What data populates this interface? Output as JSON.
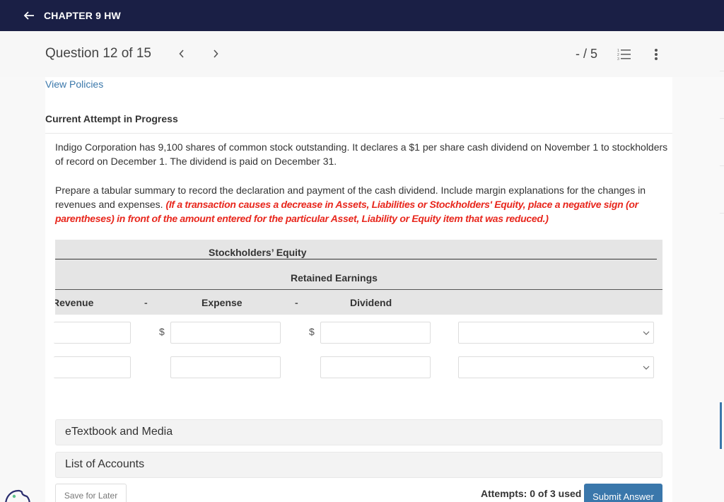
{
  "topbar": {
    "title": "CHAPTER 9 HW",
    "back_icon": "arrow-left-icon"
  },
  "question_header": {
    "title": "Question 12 of 15",
    "prev_icon": "chevron-left-icon",
    "next_icon": "chevron-right-icon",
    "score": "- / 5",
    "list_icon": "numbered-list-icon",
    "more_icon": "vertical-dots-icon"
  },
  "links": {
    "view_policies": "View Policies"
  },
  "attempt_title": "Current Attempt in Progress",
  "problem": {
    "paragraph1": "Indigo Corporation has 9,100 shares of common stock outstanding. It declares a $1 per share cash dividend on November 1 to stockholders of record on December 1. The dividend is paid on December 31.",
    "paragraph2_plain": "Prepare a tabular summary to record the declaration and payment of the cash dividend. Include margin explanations for the changes in revenues and expenses. ",
    "paragraph2_emphasis": "(If a transaction causes a decrease in Assets, Liabilities or Stockholders' Equity, place a negative sign (or parentheses) in front of the amount entered for the particular Asset, Liability or Equity item that was reduced.)"
  },
  "table": {
    "group_header": "Stockholders’ Equity",
    "sub_header": "Retained Earnings",
    "columns": [
      "Revenue",
      "-",
      "Expense",
      "-",
      "Dividend"
    ],
    "currency_symbol": "$",
    "rows": [
      {
        "revenue": "",
        "expense": "",
        "dividend": "",
        "explanation": "",
        "show_currency": true
      },
      {
        "revenue": "",
        "expense": "",
        "dividend": "",
        "explanation": "",
        "show_currency": false
      }
    ]
  },
  "accordions": [
    {
      "label": "eTextbook and Media"
    },
    {
      "label": "List of Accounts"
    }
  ],
  "footer": {
    "save_label": "Save for Later",
    "attempts": "Attempts: 0 of 3 used",
    "submit_label": "Submit Answer"
  },
  "colors": {
    "topbar": "#1a1f45",
    "link": "#3b78ab",
    "instruction_red": "#e8271d",
    "submit": "#3a77ab"
  }
}
